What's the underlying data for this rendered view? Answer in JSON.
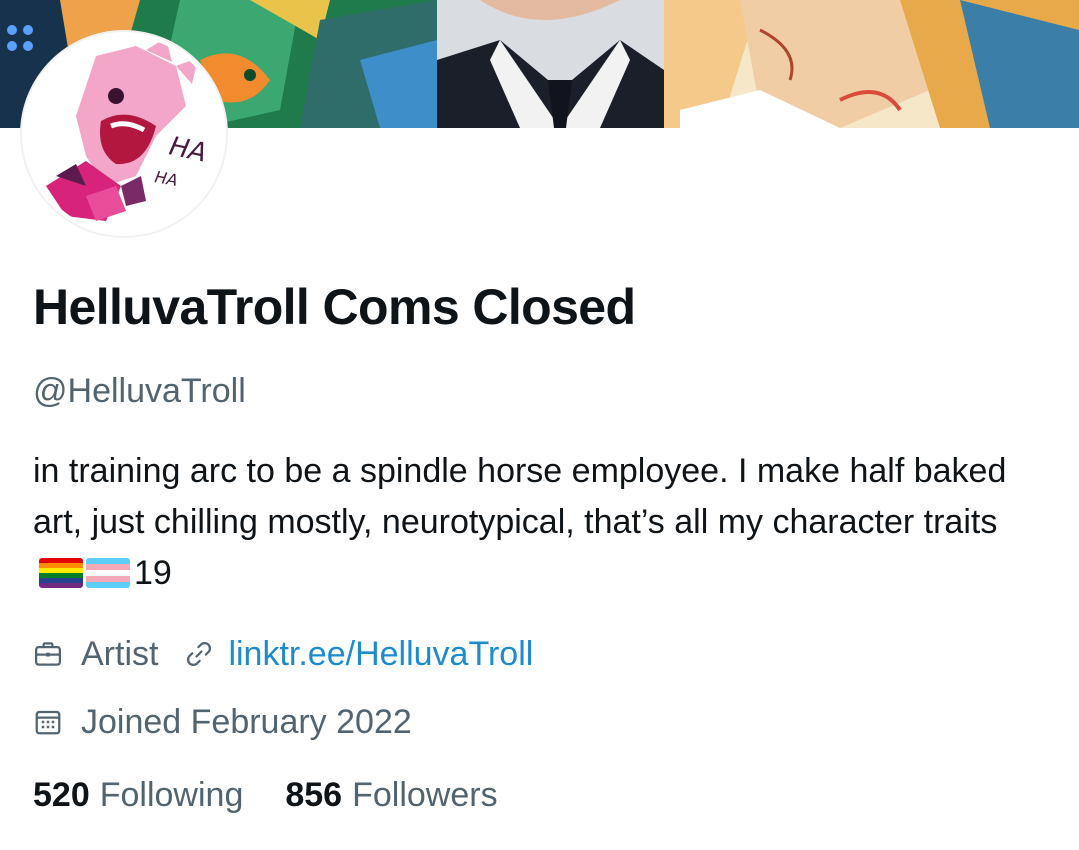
{
  "profile": {
    "display_name": "HelluvaTroll Coms Closed",
    "handle": "@HelluvaTroll",
    "bio_text": "in training arc to be a spindle horse employee. I make half baked art, just chilling mostly, neurotypical, that’s all my character traits",
    "bio_flags": [
      "rainbow-pride-flag",
      "transgender-flag"
    ],
    "bio_age": "19",
    "profession": "Artist",
    "website": "linktr.ee/HelluvaTroll",
    "joined": "Joined February 2022",
    "avatar_lettering": [
      "HA",
      "HA"
    ]
  },
  "stats": {
    "following_count": "520",
    "following_label": "Following",
    "followers_count": "856",
    "followers_label": "Followers"
  },
  "icons": {
    "profession": "briefcase-icon",
    "website": "link-icon",
    "joined": "calendar-icon"
  },
  "colors": {
    "text_primary": "#0f1419",
    "text_secondary": "#536471",
    "link": "#1d8bd0",
    "background": "#ffffff"
  }
}
